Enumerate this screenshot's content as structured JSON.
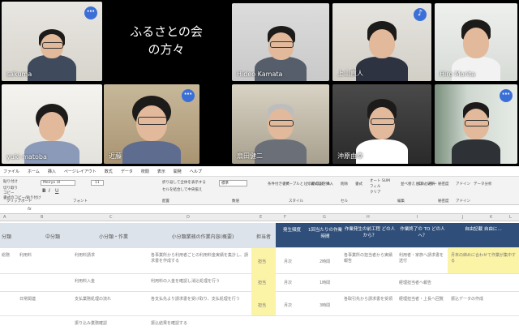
{
  "overlay_title": [
    "ふるさとの会",
    "の方々"
  ],
  "participants": [
    {
      "name": "sakuma"
    },
    {
      "name": "Hideo Kamata"
    },
    {
      "name": "上山直人"
    },
    {
      "name": "Hiro Morita"
    },
    {
      "name": "yuki matoba"
    },
    {
      "name": "近藤"
    },
    {
      "name": "扇田健二"
    },
    {
      "name": "沖原由幸"
    },
    {
      "name": ""
    }
  ],
  "more_icon": "⋯",
  "excel": {
    "menu": [
      "ファイル",
      "ホーム",
      "挿入",
      "ページレイアウト",
      "数式",
      "データ",
      "校閲",
      "表示",
      "開発",
      "ヘルプ"
    ],
    "font_name": "Meiryo UI",
    "font_size": "11",
    "wrap_label": "折り返して全体を表示する",
    "merge_label": "セルを結合して中央揃え",
    "number_format": "標準",
    "ribbon_groups": [
      "クリップボード",
      "フォント",
      "配置",
      "数値",
      "スタイル",
      "セル",
      "編集",
      "秘密度",
      "アドイン"
    ],
    "ribbon_buttons": [
      "条件付き書式",
      "テーブルとして書式設定",
      "セルのスタイル",
      "挿入",
      "削除",
      "書式",
      "オート SUM",
      "フィル",
      "クリア",
      "並べ替えとフィルター",
      "検索と選択",
      "秘密度",
      "アドイン",
      "データ分析"
    ],
    "clipboard": [
      "貼り付け",
      "切り取り",
      "コピー",
      "書式のコピー/貼り付け"
    ],
    "name_box": "",
    "fx": "fx",
    "columns": [
      "A",
      "B",
      "C",
      "D",
      "E",
      "F",
      "G",
      "H",
      "I",
      "J",
      "K",
      "L"
    ],
    "headers": [
      "分類",
      "中分類",
      "小分類・作業",
      "小分類業務の作業内容(概要)",
      "担当者",
      "発生頻度",
      "1回当たりの作業時間",
      "作業発生の前工程 どの人から？",
      "作業終了の TO どの人へ？",
      "自由記載 自由に…"
    ],
    "rows": [
      [
        "総務",
        "利用料",
        "利用料請求",
        "各事業所から利用者ごとの利用料金実績を集計し、請求書を作成する",
        "担当",
        "月次",
        "2時間",
        "各事業所の担当者から実績報告",
        "利用者・家族へ請求書を送付",
        "月末の締めに合わせて作業が集中する"
      ],
      [
        "",
        "",
        "利用料入金",
        "利用料の入金を確認し消込処理を行う",
        "担当",
        "月次",
        "1時間",
        "",
        "経理担当者へ報告",
        ""
      ],
      [
        "",
        "日常関連",
        "支払業務処理の流れ",
        "各支払先より請求書を受け取り、支払処理を行う",
        "担当",
        "月次",
        "3時間",
        "各取引先から請求書を受領",
        "経理担当者・上長へ回覧",
        "振込データの作成"
      ],
      [
        "",
        "",
        "振り込み業務確認",
        "振込結果を確認する",
        "",
        "",
        "",
        "",
        "",
        ""
      ]
    ]
  }
}
